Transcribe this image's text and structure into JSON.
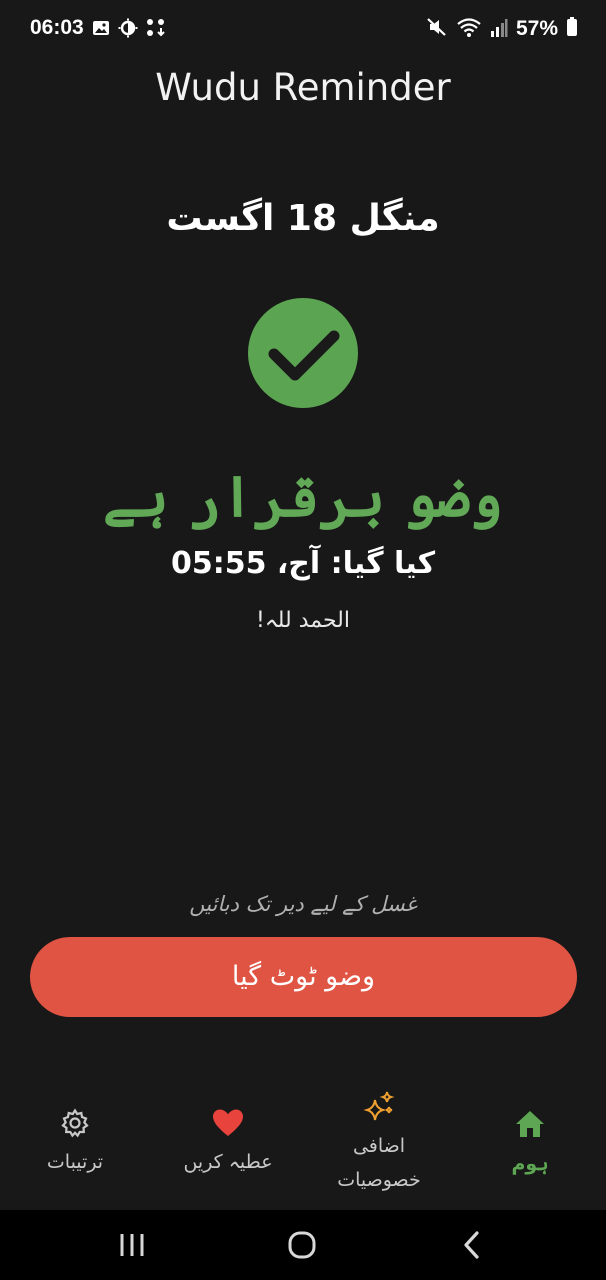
{
  "status_bar": {
    "time": "06:03",
    "battery": "57%",
    "left_icons": [
      "image-icon",
      "brightness-icon",
      "grid-download-icon"
    ],
    "right_icons": [
      "mute-icon",
      "wifi-icon",
      "signal-icon",
      "battery-icon"
    ]
  },
  "header": {
    "title": "Wudu Reminder"
  },
  "main": {
    "date": "منگل 18 اگست",
    "status": "وضو برقرار ہے",
    "status_icon": "check-circle-icon",
    "performed": "کیا گیا: آج، 05:55",
    "blessing": "الحمد للہ!",
    "hint": "غسل کے لیے دیر تک دبائیں",
    "broke_button": "وضو ٹوٹ گیا"
  },
  "nav": {
    "items": [
      {
        "label": "ترتیبات",
        "icon": "gear-icon"
      },
      {
        "label": "عطیہ کریں",
        "icon": "heart-icon"
      },
      {
        "label": "اضافی\nخصوصیات",
        "label_line1": "اضافی",
        "label_line2": "خصوصیات",
        "icon": "sparkle-icon"
      },
      {
        "label": "ہوم",
        "icon": "home-icon",
        "active": true
      }
    ]
  },
  "colors": {
    "background": "#181818",
    "accent_green": "#5ba552",
    "button_red": "#e05444",
    "sparkle_orange": "#f0a030",
    "heart_red": "#e8433d"
  }
}
